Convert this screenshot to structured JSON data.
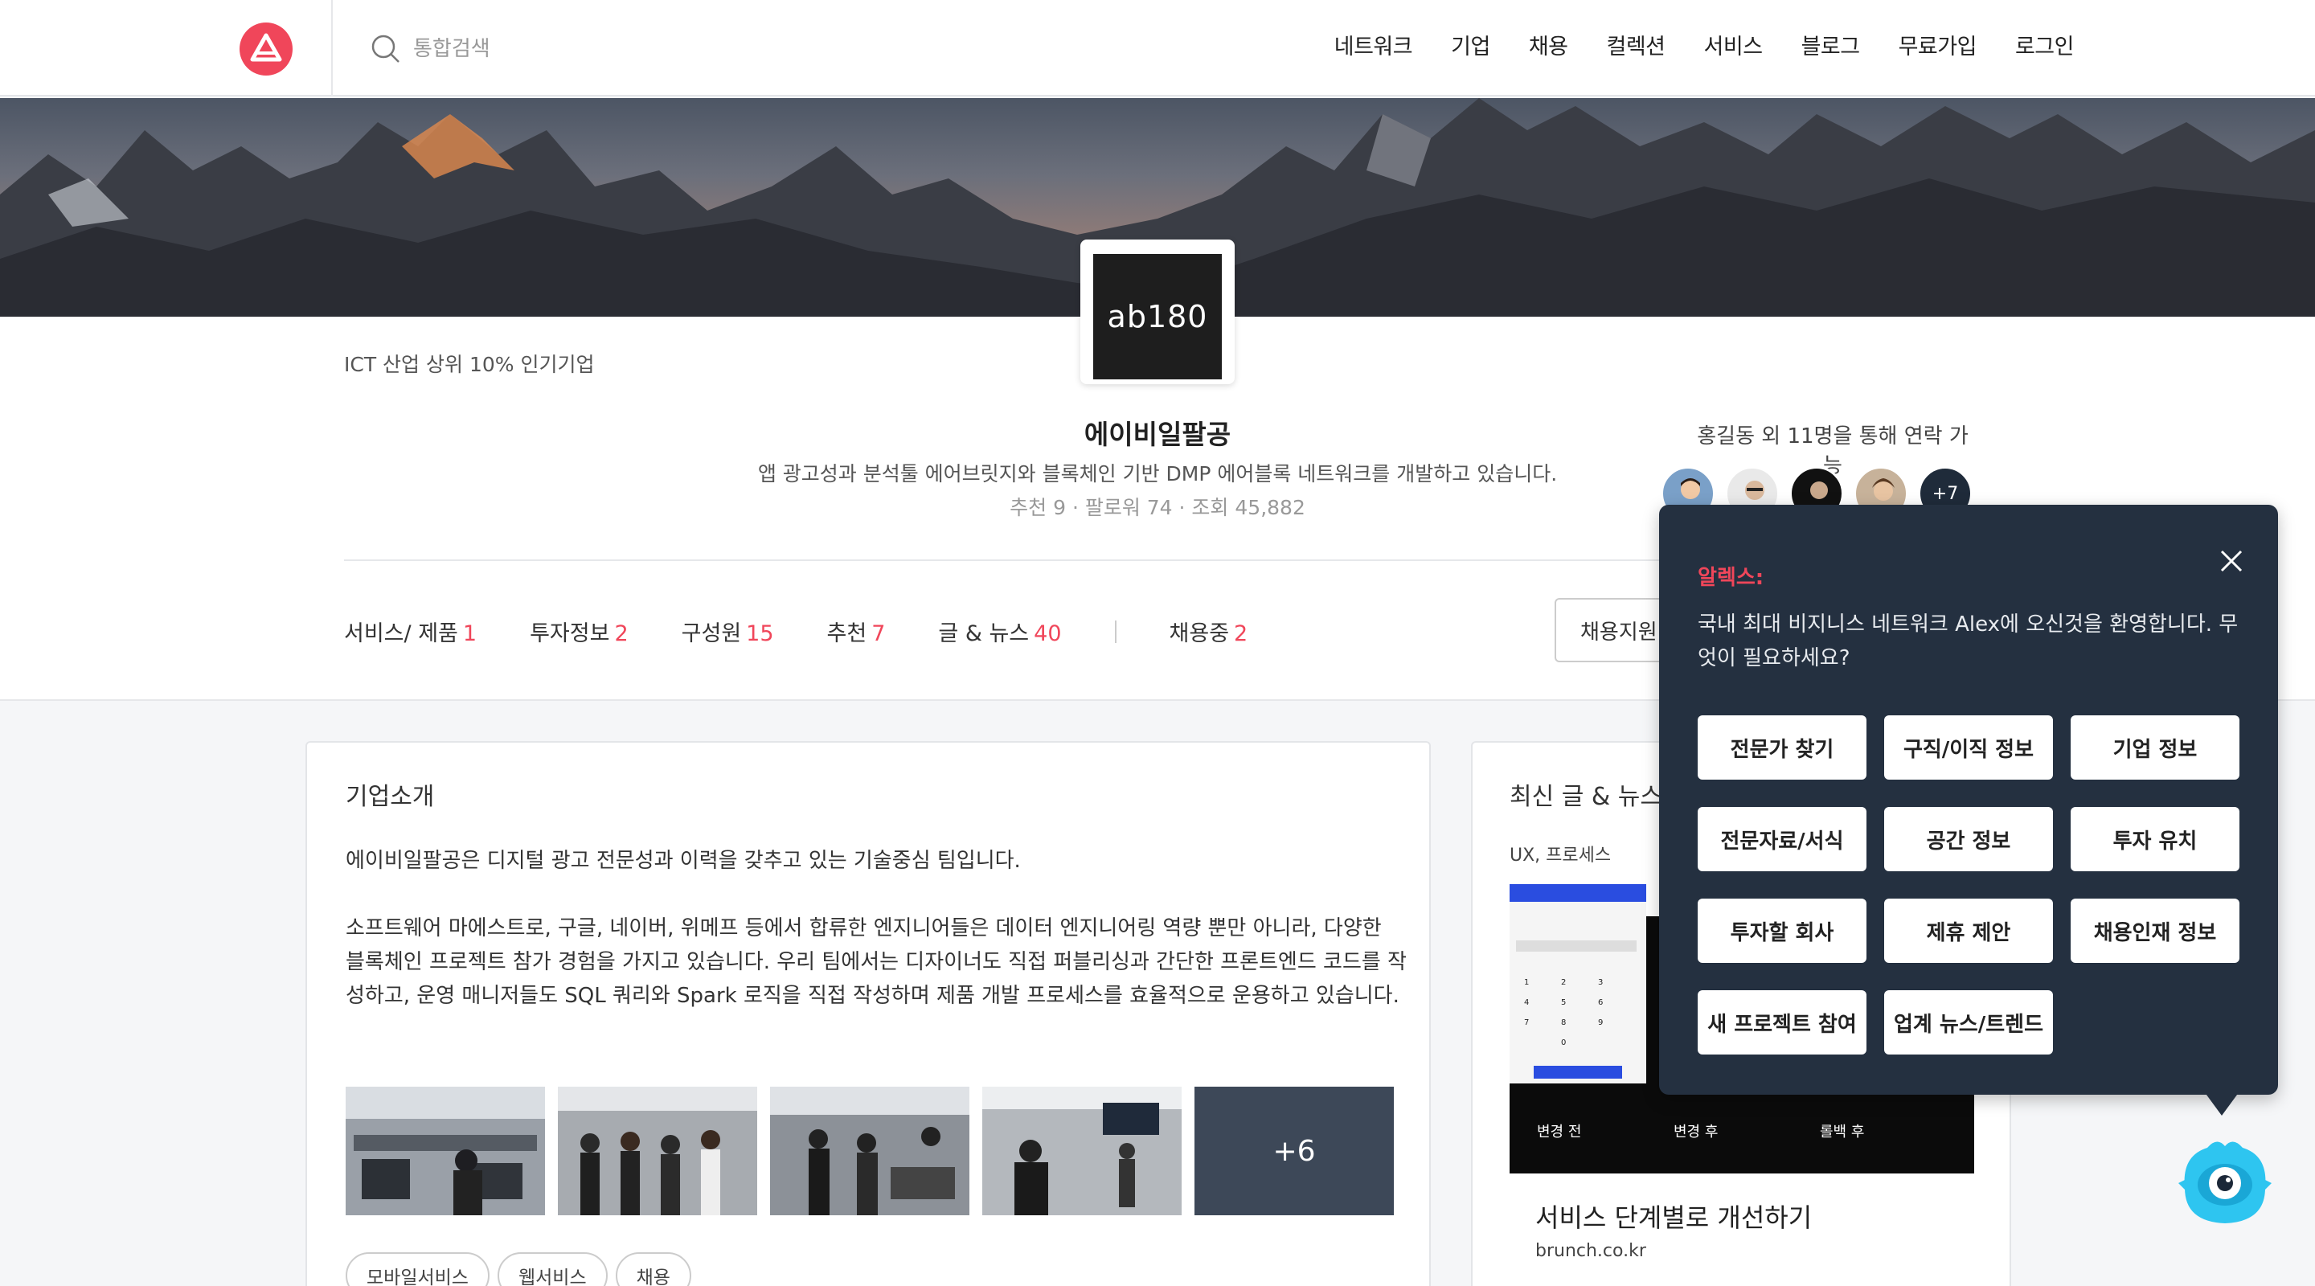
{
  "nav": {
    "search_placeholder": "통합검색",
    "menu": [
      "네트워크",
      "기업",
      "채용",
      "컬렉션",
      "서비스",
      "블로그",
      "무료가입",
      "로그인"
    ]
  },
  "profile": {
    "badge": "ICT 산업 상위 10% 인기기업",
    "logo_text": "ab180",
    "name": "에이비일팔공",
    "description": "앱 광고성과 분석툴 에어브릿지와 블록체인 기반 DMP 에어블록 네트워크를 개발하고 있습니다.",
    "stats": "추천 9 · 팔로워 74 · 조회 45,882",
    "contact_label": "홍길동 외 11명을 통해 연락 가능",
    "avatar_more": "+7",
    "tabs": [
      {
        "label": "서비스/ 제품",
        "count": "1"
      },
      {
        "label": "투자정보",
        "count": "2"
      },
      {
        "label": "구성원",
        "count": "15"
      },
      {
        "label": "추천",
        "count": "7"
      },
      {
        "label": "글 & 뉴스",
        "count": "40"
      }
    ],
    "hiring_tab": {
      "label": "채용중",
      "count": "2"
    },
    "apply_button": "채용지원"
  },
  "intro": {
    "title": "기업소개",
    "paragraphs": [
      "에이비일팔공은 디지털 광고 전문성과 이력을 갖추고 있는 기술중심 팀입니다.",
      "소프트웨어 마에스트로, 구글, 네이버, 위메프 등에서 합류한 엔지니어들은 데이터 엔지니어링 역량 뿐만 아니라, 다양한 블록체인 프로젝트 참가 경험을 가지고 있습니다. 우리 팀에서는 디자이너도 직접 퍼블리싱과 간단한 프론트엔드 코드를 작성하고, 운영 매니저들도 SQL 쿼리와 Spark 로직을 직접 작성하며 제품 개발 프로세스를 효율적으로 운용하고 있습니다."
    ],
    "photo_more": "+6",
    "tags": [
      "모바일서비스",
      "웹서비스",
      "채용"
    ]
  },
  "news": {
    "title": "최신 글 & 뉴스",
    "category": "UX, 프로세스",
    "headline": "서비스 단계별로 개선하기",
    "source": "brunch.co.kr",
    "thumb_labels": [
      "변경 전",
      "변경 후",
      "롤백 후"
    ]
  },
  "chat": {
    "bot_name": "알렉스:",
    "message": "국내 최대 비지니스 네트워크 Alex에 오신것을 환영합니다. 무엇이 필요하세요?",
    "buttons": [
      "전문가 찾기",
      "구직/이직 정보",
      "기업 정보",
      "전문자료/서식",
      "공간 정보",
      "투자 유치",
      "투자할 회사",
      "제휴 제안",
      "채용인재 정보",
      "새 프로젝트 참여",
      "업계 뉴스/트렌드"
    ]
  },
  "colors": {
    "accent": "#f0465a",
    "chat_bg": "#243040",
    "mascot": "#2ec5f0"
  }
}
